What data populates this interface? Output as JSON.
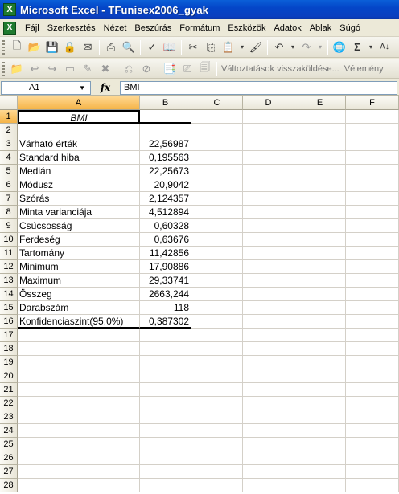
{
  "window": {
    "title": "Microsoft Excel - TFunisex2006_gyak"
  },
  "menu": [
    "Fájl",
    "Szerkesztés",
    "Nézet",
    "Beszúrás",
    "Formátum",
    "Eszközök",
    "Adatok",
    "Ablak",
    "Súgó"
  ],
  "toolbar2": {
    "review_text": "Változtatások visszaküldése...",
    "review_text2": "Vélemény"
  },
  "formula_bar": {
    "name_box": "A1",
    "fx": "fx",
    "value": "BMI"
  },
  "columns": [
    "A",
    "B",
    "C",
    "D",
    "E",
    "F"
  ],
  "rows": [
    "1",
    "2",
    "3",
    "4",
    "5",
    "6",
    "7",
    "8",
    "9",
    "10",
    "11",
    "12",
    "13",
    "14",
    "15",
    "16",
    "17",
    "18",
    "19",
    "20",
    "21",
    "22",
    "23",
    "24",
    "25",
    "26",
    "27",
    "28"
  ],
  "sheet": {
    "header": "BMI",
    "stats": [
      {
        "label": "Várható érték",
        "value": "22,56987"
      },
      {
        "label": "Standard hiba",
        "value": "0,195563"
      },
      {
        "label": "Medián",
        "value": "22,25673"
      },
      {
        "label": "Módusz",
        "value": "20,9042"
      },
      {
        "label": "Szórás",
        "value": "2,124357"
      },
      {
        "label": "Minta varianciája",
        "value": "4,512894"
      },
      {
        "label": "Csúcsosság",
        "value": "0,60328"
      },
      {
        "label": "Ferdeség",
        "value": "0,63676"
      },
      {
        "label": "Tartomány",
        "value": "11,42856"
      },
      {
        "label": "Minimum",
        "value": "17,90886"
      },
      {
        "label": "Maximum",
        "value": "29,33741"
      },
      {
        "label": "Összeg",
        "value": "2663,244"
      },
      {
        "label": "Darabszám",
        "value": "118"
      },
      {
        "label": "Konfidenciaszint(95,0%)",
        "value": "0,387302"
      }
    ]
  }
}
